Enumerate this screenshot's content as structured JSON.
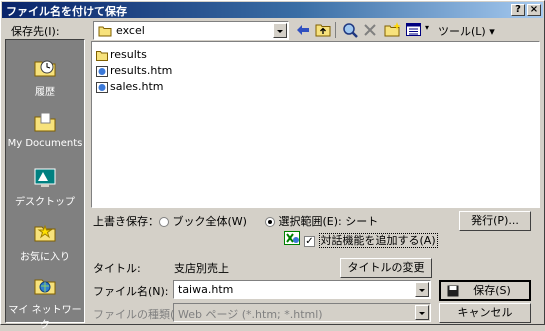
{
  "window": {
    "title": "ファイル名を付けて保存",
    "help_btn": "?",
    "close_btn": "×"
  },
  "toolbar": {
    "save_in_label": "保存先(I):",
    "save_in_value": "excel",
    "tools_label": "ツール(L)"
  },
  "places": [
    {
      "label": "履歴",
      "icon": "history-icon"
    },
    {
      "label": "My Documents",
      "icon": "my-documents-icon"
    },
    {
      "label": "デスクトップ",
      "icon": "desktop-icon"
    },
    {
      "label": "お気に入り",
      "icon": "favorites-icon"
    },
    {
      "label": "マイ ネットワーク",
      "icon": "my-network-icon"
    }
  ],
  "files": [
    {
      "name": "results",
      "type": "folder"
    },
    {
      "name": "results.htm",
      "type": "htm"
    },
    {
      "name": "sales.htm",
      "type": "htm"
    }
  ],
  "options": {
    "overwrite_label": "上書き保存：",
    "whole_book": "ブック全体(W)",
    "selection": "選択範囲(E): シート",
    "publish_btn": "発行(P)...",
    "interactive": "対話機能を追加する(A)"
  },
  "form": {
    "title_label": "タイトル:",
    "title_value": "支店別売上",
    "change_title_btn": "タイトルの変更(C)...",
    "filename_label": "ファイル名(N):",
    "filename_value": "taiwa.htm",
    "filetype_label": "ファイルの種類(T):",
    "filetype_value": "Web ページ (*.htm; *.html)",
    "save_btn": "保存(S)",
    "cancel_btn": "キャンセル"
  }
}
